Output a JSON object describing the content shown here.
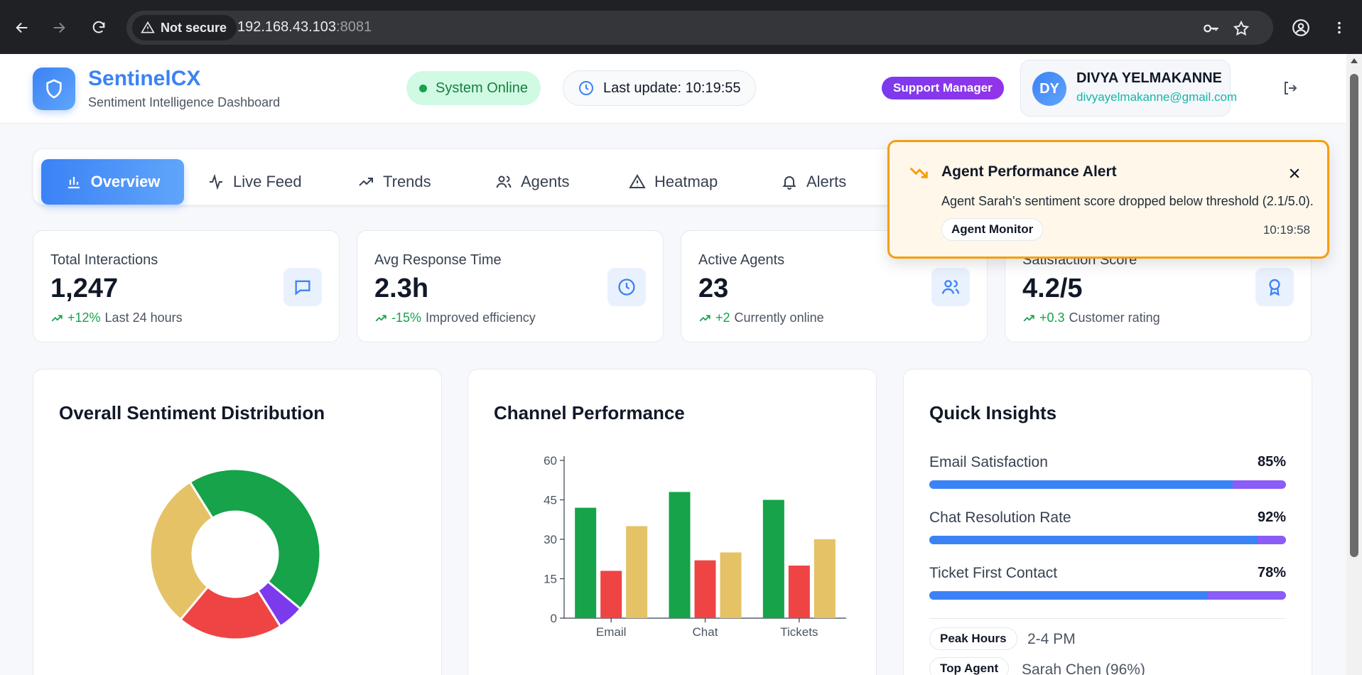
{
  "browser": {
    "security_label": "Not secure",
    "url_host": "192.168.43.103",
    "url_port": ":8081"
  },
  "header": {
    "brand": "SentinelCX",
    "subtitle": "Sentiment Intelligence Dashboard",
    "status": "System Online",
    "last_update": "Last update: 10:19:55",
    "role": "Support Manager",
    "user": {
      "initials": "DY",
      "name": "DIVYA YELMAKANNE",
      "email": "divyayelmakanne@gmail.com"
    }
  },
  "tabs": [
    {
      "label": "Overview",
      "icon": "bar-chart-icon",
      "active": true
    },
    {
      "label": "Live Feed",
      "icon": "activity-icon"
    },
    {
      "label": "Trends",
      "icon": "trending-up-icon"
    },
    {
      "label": "Agents",
      "icon": "users-icon"
    },
    {
      "label": "Heatmap",
      "icon": "warning-icon"
    },
    {
      "label": "Alerts",
      "icon": "bell-icon"
    }
  ],
  "stats": [
    {
      "label": "Total Interactions",
      "value": "1,247",
      "delta": "+12%",
      "note": "Last 24 hours",
      "icon": "message-icon"
    },
    {
      "label": "Avg Response Time",
      "value": "2.3h",
      "delta": "-15%",
      "note": "Improved efficiency",
      "icon": "clock-icon"
    },
    {
      "label": "Active Agents",
      "value": "23",
      "delta": "+2",
      "note": "Currently online",
      "icon": "users-icon"
    },
    {
      "label": "Satisfaction Score",
      "value": "4.2/5",
      "delta": "+0.3",
      "note": "Customer rating",
      "icon": "award-icon"
    }
  ],
  "sentiment": {
    "title": "Overall Sentiment Distribution"
  },
  "channel": {
    "title": "Channel Performance"
  },
  "insights": {
    "title": "Quick Insights",
    "items": [
      {
        "label": "Email Satisfaction",
        "value": "85%",
        "fraction": 0.85
      },
      {
        "label": "Chat Resolution Rate",
        "value": "92%",
        "fraction": 0.92
      },
      {
        "label": "Ticket First Contact",
        "value": "78%",
        "fraction": 0.78
      }
    ],
    "peak_label": "Peak Hours",
    "peak_value": "2-4 PM",
    "top_label": "Top Agent",
    "top_value": "Sarah Chen (96%)"
  },
  "alert": {
    "title": "Agent Performance Alert",
    "message": "Agent Sarah's sentiment score dropped below threshold (2.1/5.0).",
    "tag": "Agent Monitor",
    "time": "10:19:58"
  },
  "chart_data": [
    {
      "type": "pie",
      "donut": true,
      "title": "Overall Sentiment Distribution",
      "slices": [
        {
          "value": 45,
          "color": "#16a34a"
        },
        {
          "value": 5,
          "color": "#7c3aed"
        },
        {
          "value": 20,
          "color": "#ef4444"
        },
        {
          "value": 30,
          "color": "#e5c266"
        }
      ]
    },
    {
      "type": "bar",
      "title": "Channel Performance",
      "categories": [
        "Email",
        "Chat",
        "Tickets"
      ],
      "series": [
        {
          "values": [
            42,
            48,
            45
          ],
          "color": "#16a34a"
        },
        {
          "values": [
            18,
            22,
            20
          ],
          "color": "#ef4444"
        },
        {
          "values": [
            35,
            25,
            30
          ],
          "color": "#e5c266"
        }
      ],
      "ylim": [
        0,
        60
      ],
      "yticks": [
        0,
        15,
        30,
        45,
        60
      ],
      "grid": false
    }
  ]
}
